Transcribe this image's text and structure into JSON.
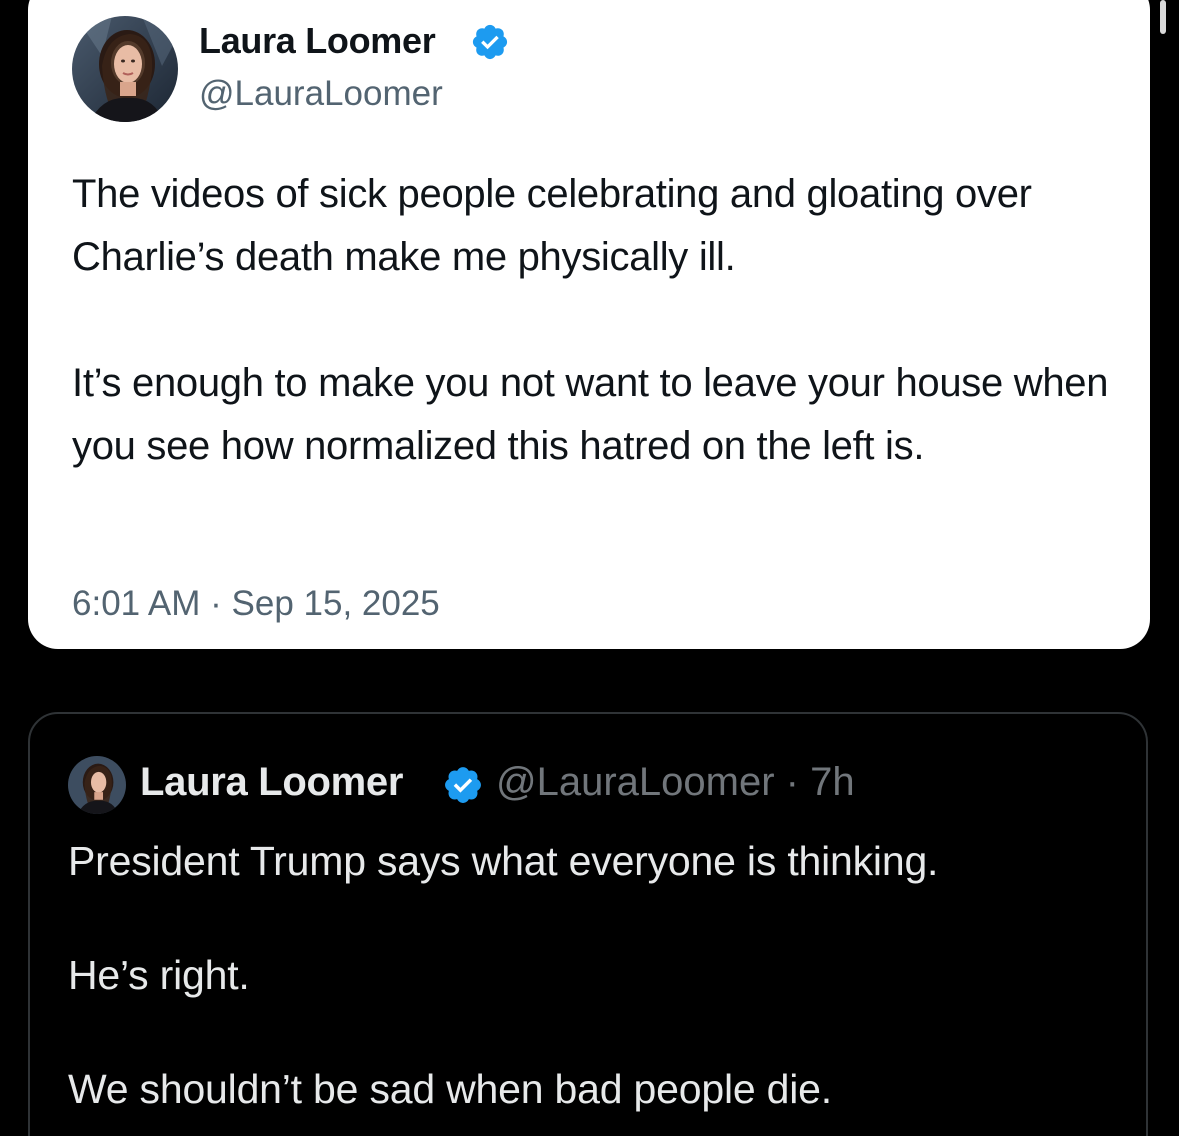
{
  "main_tweet": {
    "author_name": "Laura Loomer",
    "handle": "@LauraLoomer",
    "verified_icon": "verified-badge-icon",
    "paragraphs": [
      "The videos of sick people celebrating and gloating over Charlie’s death make me physically ill.",
      "It’s enough to make you not want to leave your house when you see how normalized this hatred on the left is."
    ],
    "timestamp": "6:01 AM · Sep 15, 2025"
  },
  "quoted_tweet": {
    "author_name": "Laura Loomer",
    "handle_time": "@LauraLoomer · 7h",
    "verified_icon": "verified-badge-icon",
    "paragraphs": [
      "President Trump says what everyone is thinking.",
      "He’s right.",
      "We shouldn’t be sad when bad people die."
    ]
  },
  "colors": {
    "page_background": "#000000",
    "card_white": "#ffffff",
    "verified_blue": "#1d9bf0",
    "text_dark": "#0f1419",
    "text_muted_light": "#536471",
    "text_light": "#e7e9ea",
    "text_muted_dark": "#71767b",
    "dark_card_border": "#2f3336"
  }
}
